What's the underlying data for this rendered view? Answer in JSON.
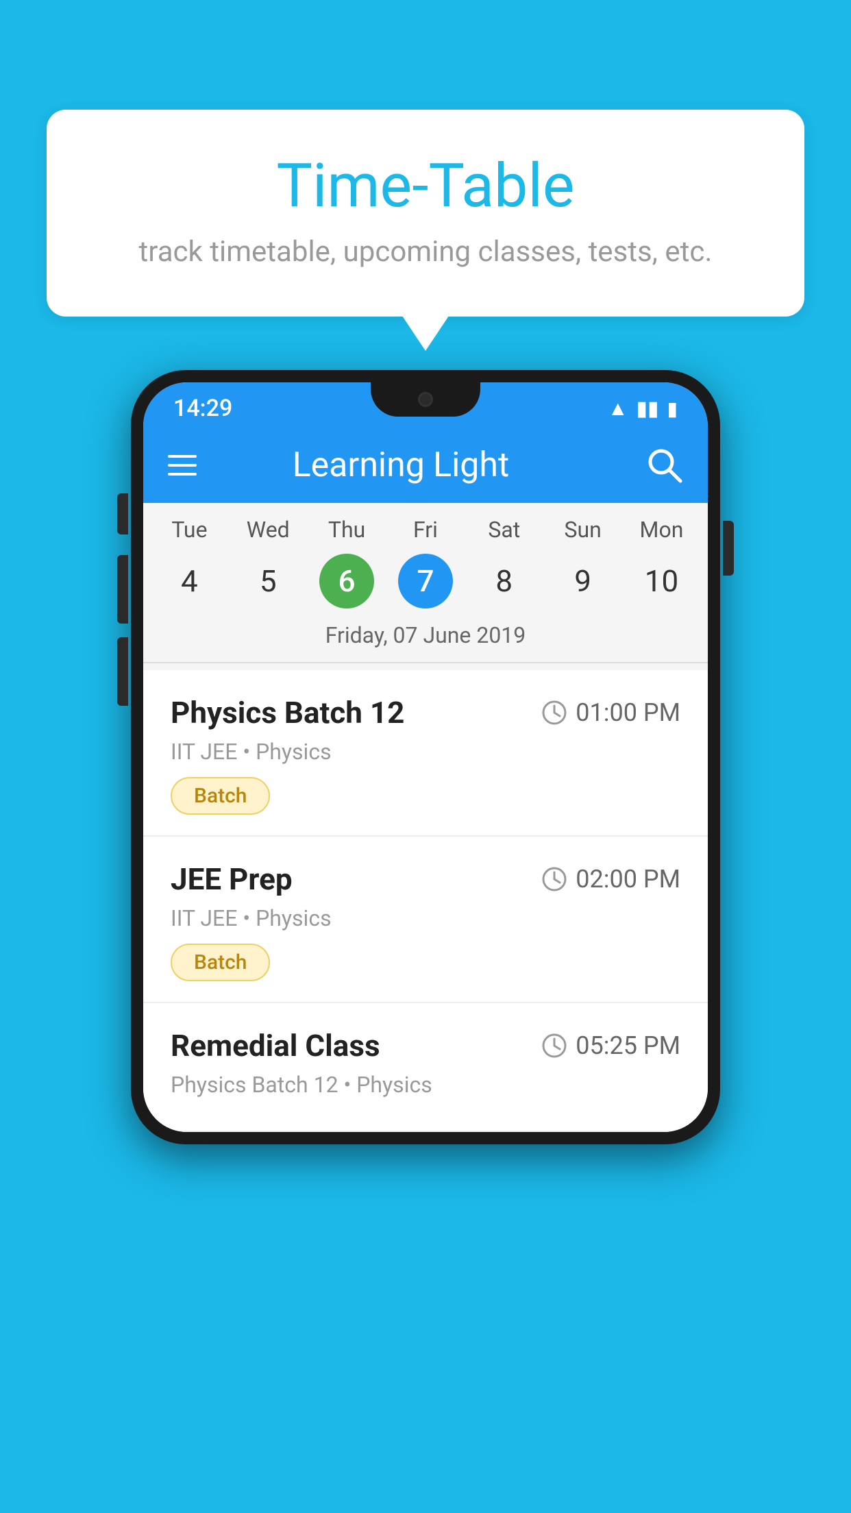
{
  "background_color": "#1BB8E8",
  "speech_bubble": {
    "title": "Time-Table",
    "subtitle": "track timetable, upcoming classes, tests, etc."
  },
  "phone": {
    "status_bar": {
      "time": "14:29",
      "icons": [
        "wifi",
        "signal",
        "battery"
      ]
    },
    "app_bar": {
      "title": "Learning Light",
      "menu_icon_label": "menu",
      "search_icon_label": "search"
    },
    "calendar": {
      "days": [
        {
          "label": "Tue",
          "num": "4",
          "state": "normal"
        },
        {
          "label": "Wed",
          "num": "5",
          "state": "normal"
        },
        {
          "label": "Thu",
          "num": "6",
          "state": "today"
        },
        {
          "label": "Fri",
          "num": "7",
          "state": "selected"
        },
        {
          "label": "Sat",
          "num": "8",
          "state": "normal"
        },
        {
          "label": "Sun",
          "num": "9",
          "state": "normal"
        },
        {
          "label": "Mon",
          "num": "10",
          "state": "normal"
        }
      ],
      "selected_date_label": "Friday, 07 June 2019"
    },
    "schedule": [
      {
        "title": "Physics Batch 12",
        "time": "01:00 PM",
        "meta": "IIT JEE • Physics",
        "badge": "Batch"
      },
      {
        "title": "JEE Prep",
        "time": "02:00 PM",
        "meta": "IIT JEE • Physics",
        "badge": "Batch"
      },
      {
        "title": "Remedial Class",
        "time": "05:25 PM",
        "meta": "Physics Batch 12 • Physics",
        "badge": null
      }
    ]
  }
}
